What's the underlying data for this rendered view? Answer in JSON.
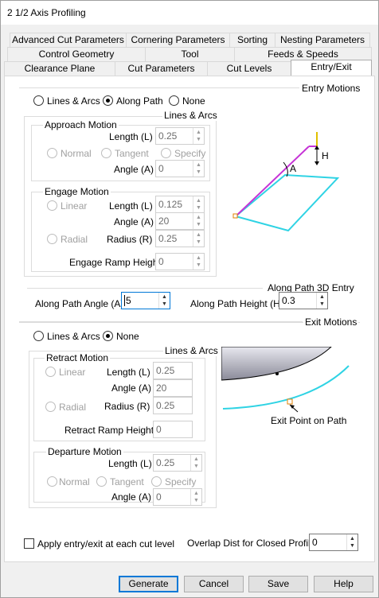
{
  "window": {
    "title": "2 1/2 Axis Profiling"
  },
  "tabs": {
    "row1": [
      "Advanced Cut Parameters",
      "Cornering Parameters",
      "Sorting",
      "Nesting Parameters"
    ],
    "row2": [
      "Control Geometry",
      "Tool",
      "Feeds & Speeds"
    ],
    "row3": [
      "Clearance Plane",
      "Cut Parameters",
      "Cut Levels",
      "Entry/Exit"
    ]
  },
  "entry": {
    "title": "Entry Motions",
    "options": [
      "Lines & Arcs",
      "Along Path",
      "None"
    ],
    "lines_arcs_title": "Lines & Arcs",
    "approach": {
      "title": "Approach Motion",
      "length_label": "Length (L)",
      "length": "0.25",
      "normal": "Normal",
      "tangent": "Tangent",
      "specify": "Specify",
      "angle_label": "Angle (A)",
      "angle": "0"
    },
    "engage": {
      "title": "Engage Motion",
      "linear": "Linear",
      "length_label": "Length (L)",
      "length": "0.125",
      "angle_label": "Angle (A)",
      "angle": "20",
      "radial": "Radial",
      "radius_label": "Radius (R)",
      "radius": "0.25",
      "ramp_label": "Engage Ramp Height",
      "ramp": "0"
    },
    "along_path": {
      "title": "Along Path 3D Entry",
      "angle_label": "Along Path Angle (A)",
      "angle": "5",
      "height_label": "Along Path Height (H)",
      "height": "0.3"
    },
    "diagram": {
      "h_label": "H",
      "a_label": "A"
    }
  },
  "exit": {
    "title": "Exit Motions",
    "options": [
      "Lines & Arcs",
      "None"
    ],
    "lines_arcs_title": "Lines & Arcs",
    "retract": {
      "title": "Retract Motion",
      "linear": "Linear",
      "length_label": "Length (L)",
      "length": "0.25",
      "angle_label": "Angle (A)",
      "angle": "20",
      "radial": "Radial",
      "radius_label": "Radius (R)",
      "radius": "0.25",
      "ramp_label": "Retract Ramp Height",
      "ramp": "0"
    },
    "departure": {
      "title": "Departure Motion",
      "length_label": "Length (L)",
      "length": "0.25",
      "normal": "Normal",
      "tangent": "Tangent",
      "specify": "Specify",
      "angle_label": "Angle (A)",
      "angle": "0"
    },
    "diagram": {
      "caption": "Exit Point on Path"
    }
  },
  "bottom": {
    "apply_label": "Apply entry/exit at each cut level",
    "overlap_label": "Overlap Dist for Closed Profiles",
    "overlap": "0"
  },
  "buttons": {
    "generate": "Generate",
    "cancel": "Cancel",
    "save": "Save",
    "help": "Help"
  }
}
